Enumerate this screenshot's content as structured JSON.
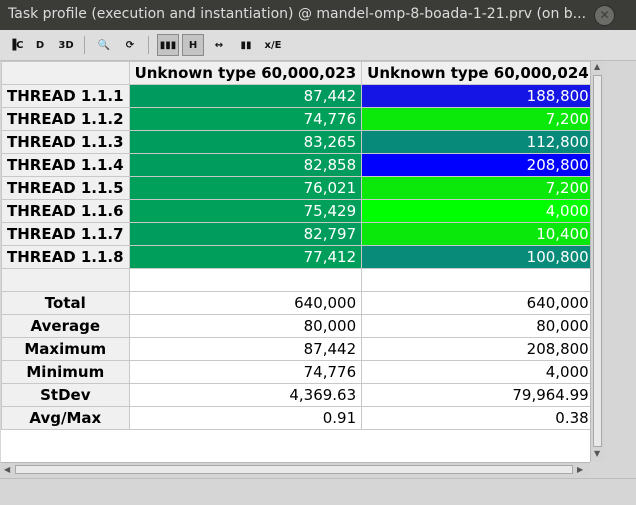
{
  "window": {
    "title": "Task profile (execution and instantiation) @ mandel-omp-8-boada-1-21.prv (on b..."
  },
  "toolbar": {
    "buttons": [
      {
        "name": "show-semantic-icon",
        "glyph": "▐C"
      },
      {
        "name": "histogram-2d-icon",
        "glyph": "D"
      },
      {
        "name": "histogram-3d-icon",
        "glyph": "3D"
      },
      {
        "name": "zoom-icon",
        "glyph": "🔍"
      },
      {
        "name": "open-control-window-icon",
        "glyph": "⟳"
      },
      {
        "name": "gradient-color-icon",
        "glyph": "▮▮▮",
        "pressed": true
      },
      {
        "name": "horizontal-mode-icon",
        "glyph": "H",
        "pressed": true
      },
      {
        "name": "hide-empty-icon",
        "glyph": "↔"
      },
      {
        "name": "label-colors-icon",
        "glyph": "▮▮"
      },
      {
        "name": "scientific-notation-icon",
        "glyph": "x/E"
      }
    ]
  },
  "table": {
    "columns": [
      "Unknown type 60,000,023",
      "Unknown type 60,000,024"
    ],
    "rows": [
      {
        "label": "THREAD 1.1.1",
        "values": [
          "87,442",
          "188,800"
        ],
        "colors": [
          "#009a5f",
          "#1515e6"
        ]
      },
      {
        "label": "THREAD 1.1.2",
        "values": [
          "74,776",
          "7,200"
        ],
        "colors": [
          "#00a05a",
          "#0ae90a"
        ]
      },
      {
        "label": "THREAD 1.1.3",
        "values": [
          "83,265",
          "112,800"
        ],
        "colors": [
          "#009c5d",
          "#078a7a"
        ]
      },
      {
        "label": "THREAD 1.1.4",
        "values": [
          "82,858",
          "208,800"
        ],
        "colors": [
          "#009c5d",
          "#0000ff"
        ]
      },
      {
        "label": "THREAD 1.1.5",
        "values": [
          "76,021",
          "7,200"
        ],
        "colors": [
          "#00a05a",
          "#0ae90a"
        ]
      },
      {
        "label": "THREAD 1.1.6",
        "values": [
          "75,429",
          "4,000"
        ],
        "colors": [
          "#00a05a",
          "#00ff00"
        ]
      },
      {
        "label": "THREAD 1.1.7",
        "values": [
          "82,797",
          "10,400"
        ],
        "colors": [
          "#009c5d",
          "#0ae70b"
        ]
      },
      {
        "label": "THREAD 1.1.8",
        "values": [
          "77,412",
          "100,800"
        ],
        "colors": [
          "#009e5b",
          "#088b78"
        ]
      }
    ],
    "stats": [
      {
        "label": "Total",
        "values": [
          "640,000",
          "640,000"
        ]
      },
      {
        "label": "Average",
        "values": [
          "80,000",
          "80,000"
        ]
      },
      {
        "label": "Maximum",
        "values": [
          "87,442",
          "208,800"
        ]
      },
      {
        "label": "Minimum",
        "values": [
          "74,776",
          "4,000"
        ]
      },
      {
        "label": "StDev",
        "values": [
          "4,369.63",
          "79,964.99"
        ]
      },
      {
        "label": "Avg/Max",
        "values": [
          "0.91",
          "0.38"
        ]
      }
    ]
  }
}
